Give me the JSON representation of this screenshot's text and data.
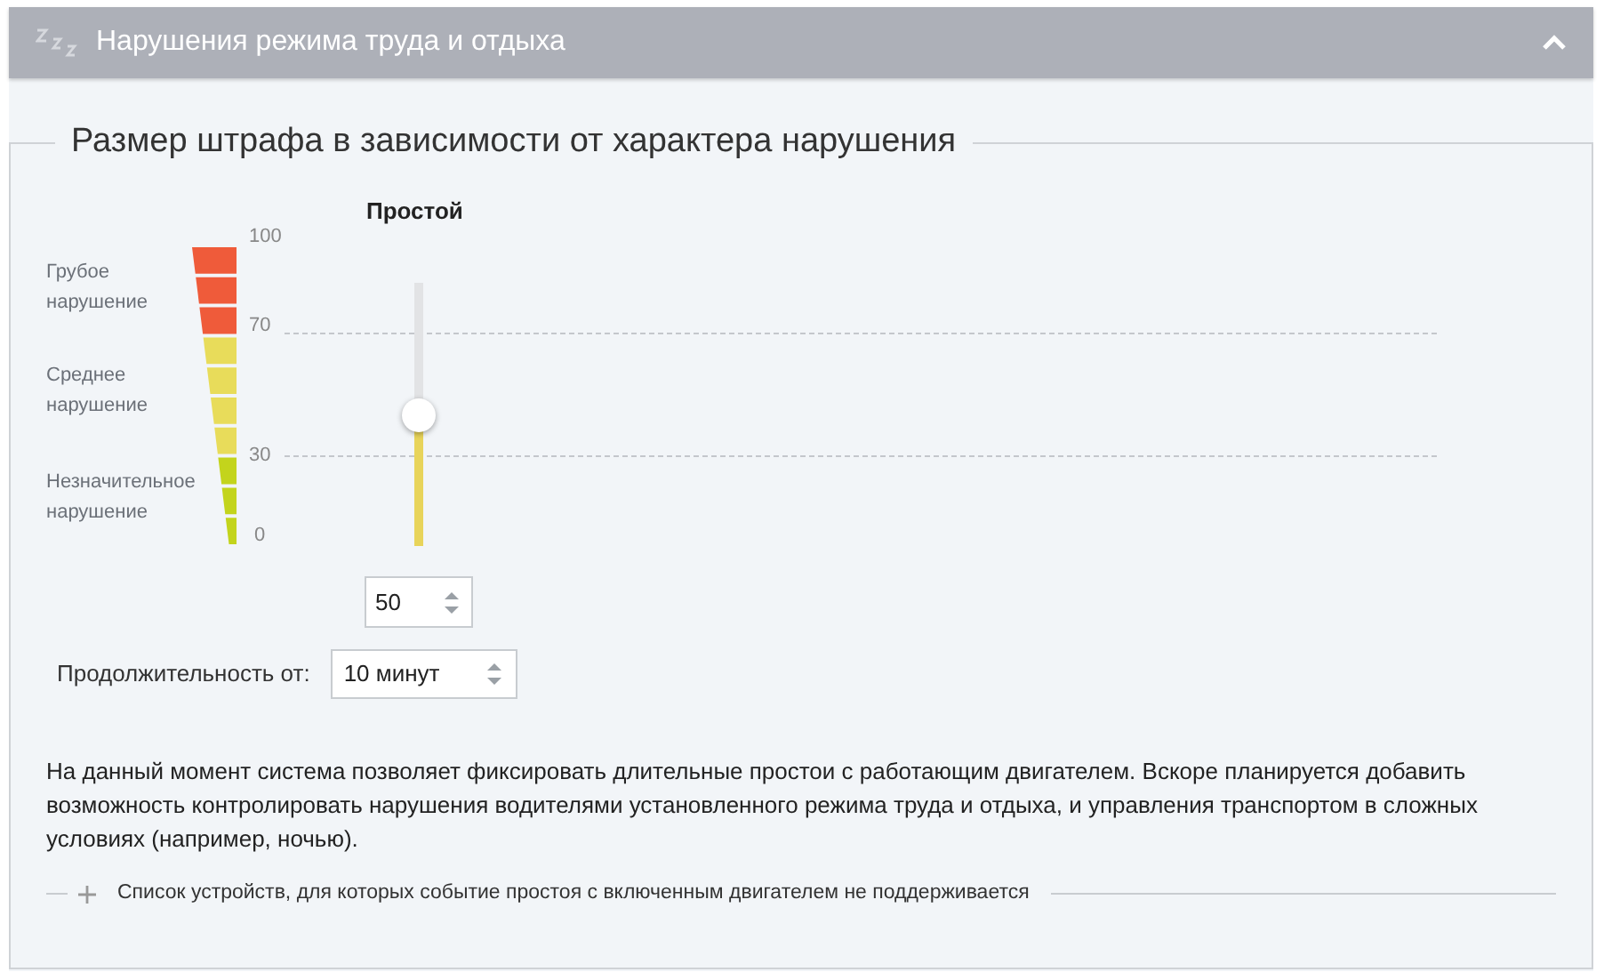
{
  "section": {
    "title": "Нарушения режима труда и отдыха",
    "expanded": true
  },
  "group_title": "Размер штрафа в зависимости от характера нарушения",
  "severity_labels": [
    "Грубое нарушение",
    "Среднее нарушение",
    "Незначительное нарушение"
  ],
  "scale_ticks": [
    "100",
    "70",
    "30",
    "0"
  ],
  "scale_segments": [
    {
      "color": "#ef5b3a"
    },
    {
      "color": "#ef5b3a"
    },
    {
      "color": "#ef5b3a"
    },
    {
      "color": "#e8dc5a"
    },
    {
      "color": "#e8dc5a"
    },
    {
      "color": "#e8dc5a"
    },
    {
      "color": "#e8dc5a"
    },
    {
      "color": "#c3d41c"
    },
    {
      "color": "#c3d41c"
    },
    {
      "color": "#c3d41c"
    }
  ],
  "slider": {
    "title": "Простой",
    "level": 0.5
  },
  "fine_field": {
    "value": "50"
  },
  "duration": {
    "label": "Продолжительность от:",
    "value": "10 минут"
  },
  "note": "На данный момент система позволяет фиксировать длительные простои с работающим двигателем. Вскоре планируется добавить возможность контролировать нарушения водителями установленного режима труда и отдыха, и управления транспортом в сложных условиях (например, ночью).",
  "device_list": {
    "label": "Список устройств, для которых событие простоя с включенным двигателем не поддерживается",
    "expanded": false
  }
}
